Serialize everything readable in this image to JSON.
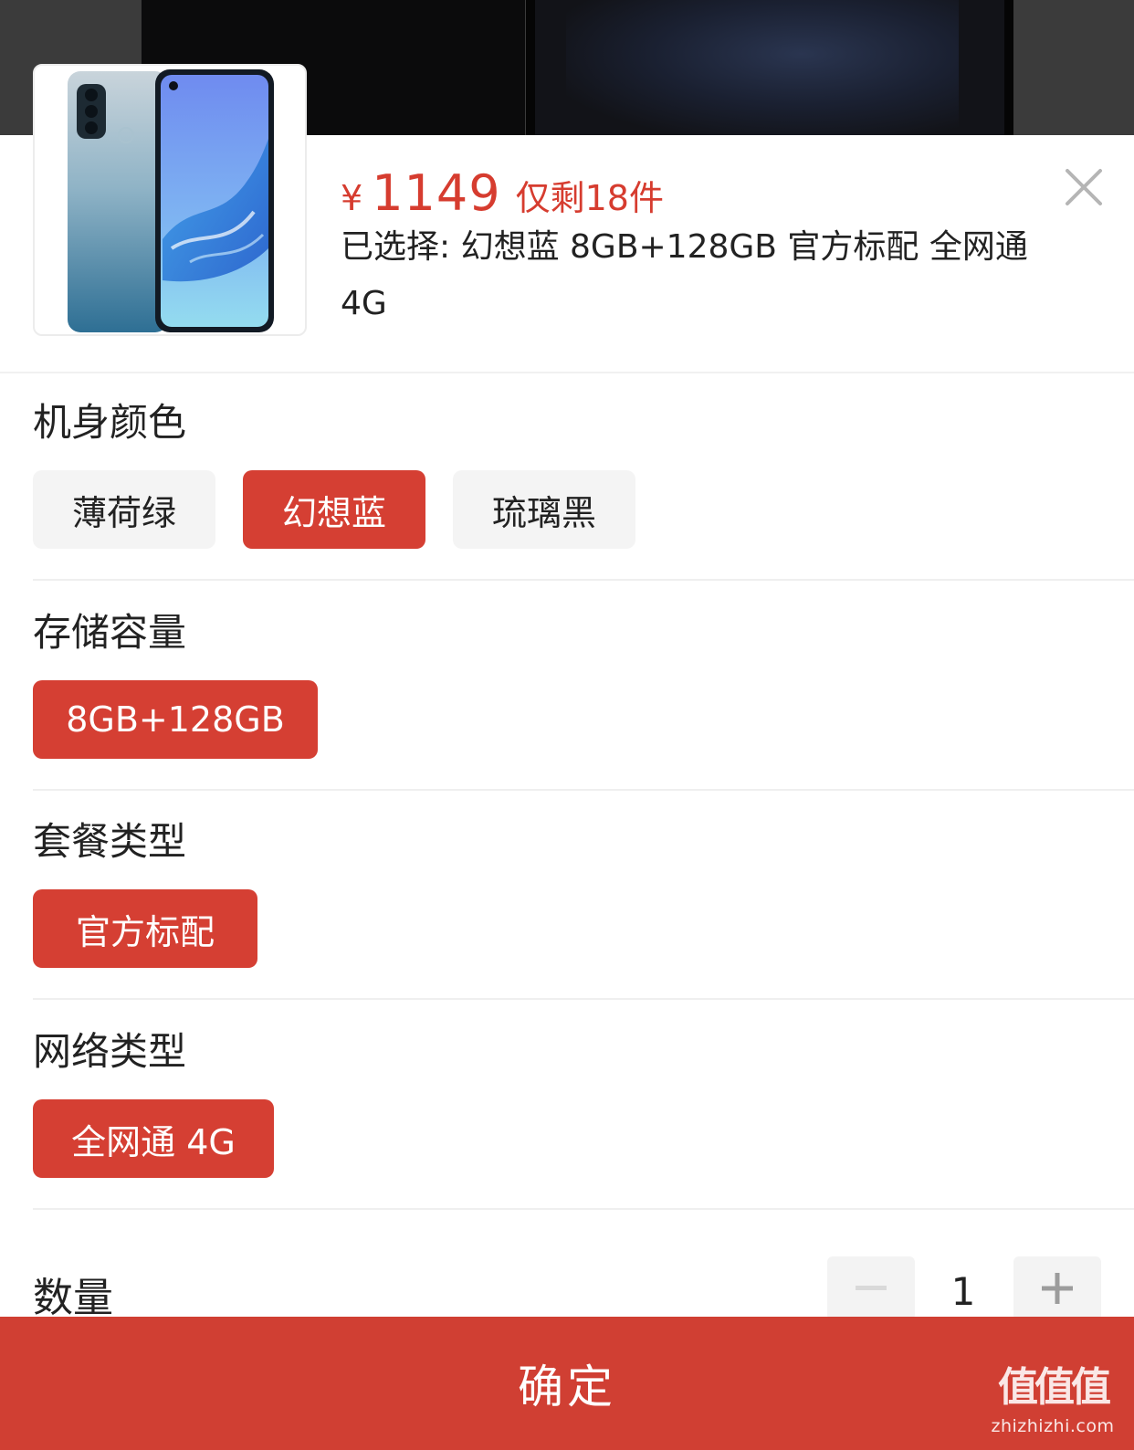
{
  "product": {
    "price_symbol": "¥",
    "price": "1149",
    "stock": "仅剩18件",
    "selected_summary": "已选择: 幻想蓝 8GB+128GB 官方标配 全网通 4G",
    "thumbnail_icon": "phone-product-image"
  },
  "groups": {
    "color": {
      "title": "机身颜色",
      "options": [
        "薄荷绿",
        "幻想蓝",
        "琉璃黑"
      ],
      "selected": "幻想蓝"
    },
    "storage": {
      "title": "存储容量",
      "options": [
        "8GB+128GB"
      ],
      "selected": "8GB+128GB"
    },
    "package": {
      "title": "套餐类型",
      "options": [
        "官方标配"
      ],
      "selected": "官方标配"
    },
    "network": {
      "title": "网络类型",
      "options": [
        "全网通 4G"
      ],
      "selected": "全网通 4G"
    }
  },
  "quantity": {
    "label": "数量",
    "value": "1",
    "minus_icon": "minus-icon",
    "plus_icon": "plus-icon"
  },
  "confirm_label": "确定",
  "watermark": {
    "logo": "值值值",
    "url": "zhizhizhi.com"
  },
  "colors": {
    "accent": "#d53f33",
    "option_bg": "#f4f4f4",
    "price": "#d63c2f"
  }
}
